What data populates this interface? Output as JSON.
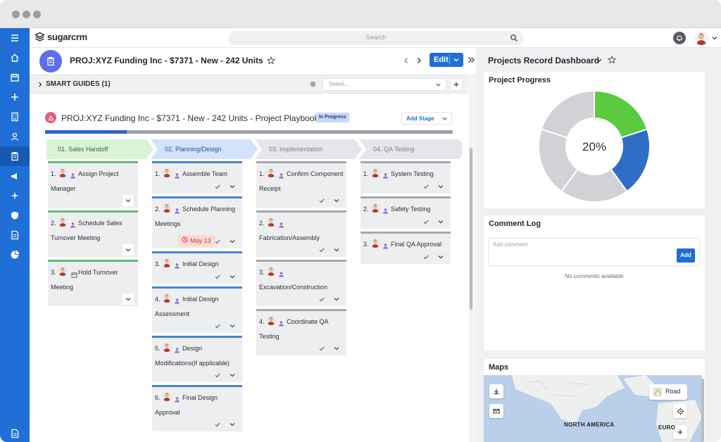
{
  "app": {
    "brand": "sugarcrm",
    "accent": "#1f6fd6"
  },
  "search": {
    "placeholder": "Search"
  },
  "record": {
    "title": "PROJ:XYZ Funding Inc - $7371 - New - 242 Units",
    "edit_label": "Edit"
  },
  "smart_guides": {
    "title": "SMART GUIDES (1)",
    "select_placeholder": "Select..."
  },
  "playbook": {
    "title": "PROJ:XYZ Funding Inc - $7371 - New - 242 Units - Project Playbook",
    "status": "In Progress",
    "add_stage_label": "Add Stage",
    "progress_fraction": 0.2
  },
  "stages": [
    {
      "label": "01. Sales Handoff",
      "color": "#d8f3d5",
      "text_color": "#2d6b35",
      "tasks": [
        {
          "num": "1.",
          "line1": "Assign Project",
          "line2": "Manager",
          "icon": "user-icon"
        },
        {
          "num": "2.",
          "line1": "Schedule Sales",
          "line2": "Turnover Meeting",
          "icon": "user-icon"
        },
        {
          "num": "3.",
          "line1": "Hold Turnover",
          "line2": "Meeting",
          "icon": "calendar-icon"
        }
      ]
    },
    {
      "label": "02. Planning/Design",
      "color": "#d2e3fb",
      "text_color": "#1f4e9a",
      "tasks": [
        {
          "num": "1.",
          "line1": "Assemble Team",
          "line2": "",
          "icon": "user-icon"
        },
        {
          "num": "2.",
          "line1": "Schedule Planning",
          "line2": "Meetings",
          "icon": "user-icon",
          "due": "May 13"
        },
        {
          "num": "3.",
          "line1": "Initial Design",
          "line2": "",
          "icon": "user-icon"
        },
        {
          "num": "4.",
          "line1": "Initial Design",
          "line2": "Assessment",
          "icon": "user-icon"
        },
        {
          "num": "5.",
          "line1": "Design",
          "line2": "Modifications(if applicable)",
          "icon": "user-icon"
        },
        {
          "num": "6.",
          "line1": "Final Design",
          "line2": "Approval",
          "icon": "user-icon"
        }
      ]
    },
    {
      "label": "03. Implementation",
      "color": "#e4e6e9",
      "text_color": "#7b8086",
      "tasks": [
        {
          "num": "1.",
          "line1": "Confirm Component",
          "line2": "Receipt",
          "icon": "user-icon"
        },
        {
          "num": "2.",
          "line1": "",
          "line2": "Fabrication/Assembly",
          "icon": "user-icon"
        },
        {
          "num": "3.",
          "line1": "",
          "line2": "Excavation/Construction",
          "icon": "user-icon"
        },
        {
          "num": "4.",
          "line1": "Coordinate QA",
          "line2": "Testing",
          "icon": "user-icon"
        }
      ]
    },
    {
      "label": "04. QA Testing",
      "color": "#e4e6e9",
      "text_color": "#7b8086",
      "tasks": [
        {
          "num": "1.",
          "line1": "System Testing",
          "line2": "",
          "icon": "user-icon"
        },
        {
          "num": "2.",
          "line1": "Safety Testing",
          "line2": "",
          "icon": "user-icon"
        },
        {
          "num": "3.",
          "line1": "Final QA Approval",
          "line2": "",
          "icon": "user-icon"
        }
      ]
    }
  ],
  "dashboard": {
    "title": "Projects Record Dashboard",
    "progress": {
      "title": "Project Progress",
      "center_label": "20%",
      "slices": [
        {
          "value": 20,
          "color": "#5acb3f"
        },
        {
          "value": 20,
          "color": "#2f6ec5"
        },
        {
          "value": 20,
          "color": "#d0d2d5"
        },
        {
          "value": 20,
          "color": "#d0d2d5"
        },
        {
          "value": 20,
          "color": "#d0d2d5"
        }
      ]
    },
    "comments": {
      "title": "Comment Log",
      "placeholder": "Add comment",
      "add_label": "Add",
      "empty_text": "No comments available"
    },
    "maps": {
      "title": "Maps",
      "road_label": "Road",
      "labels": [
        "NORTH AMERICA",
        "EURO"
      ]
    }
  }
}
